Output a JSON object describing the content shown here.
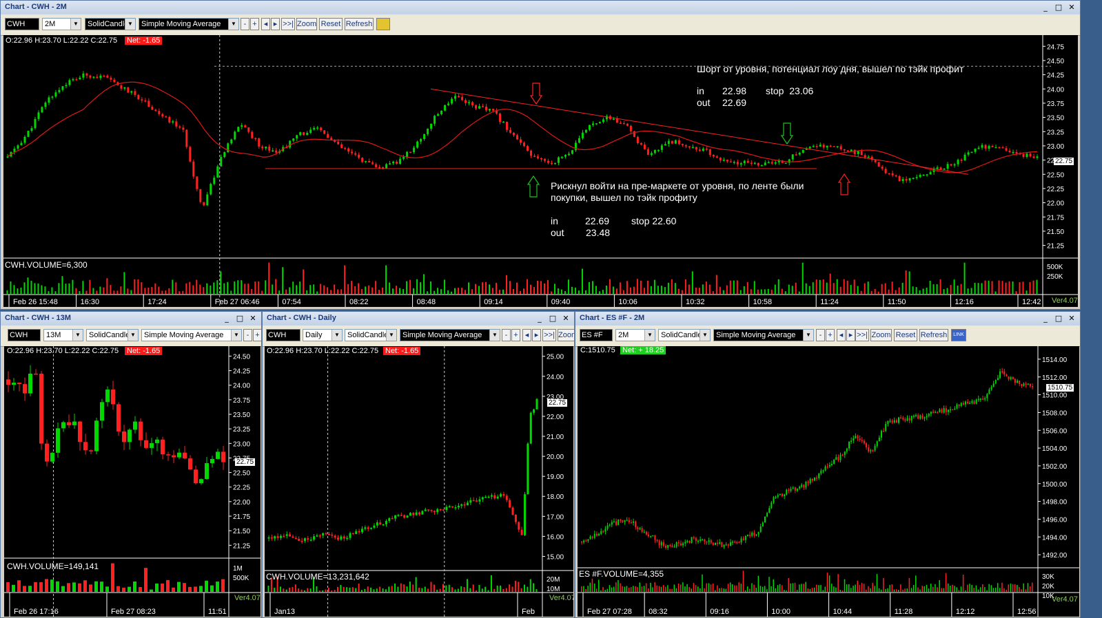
{
  "colors": {
    "up": "#00d800",
    "down": "#ff2020",
    "ma": "#e01818",
    "window_bg": "#d4d0c8",
    "net_neg": "#ff1a1a",
    "net_pos": "#20d020"
  },
  "toolbar_common": {
    "chart_type": "SolidCandle",
    "indicator": "Simple Moving Average",
    "minus": "-",
    "plus": "+",
    "left": "◂",
    "right": "▸",
    "end": ">>|",
    "zoom": "Zoom",
    "reset": "Reset",
    "refresh": "Refresh"
  },
  "main": {
    "title": "Chart - CWH - 2M",
    "symbol": "CWH",
    "interval": "2M",
    "ohlc": "O:22.96   H:23.70   L:22.22   C:22.75",
    "net": "Net: -1.65",
    "volume_label": "CWH.VOLUME=6,300",
    "y_ticks": [
      "24.75",
      "24.50",
      "24.25",
      "24.00",
      "23.75",
      "23.50",
      "23.25",
      "23.00",
      "22.75",
      "22.50",
      "22.25",
      "22.00",
      "21.75",
      "21.50",
      "21.25"
    ],
    "vol_ticks": [
      "500K",
      "250K"
    ],
    "x_ticks": [
      "Feb 26 15:48",
      "16:30",
      "17:24",
      "Feb 27 06:46",
      "07:54",
      "08:22",
      "08:48",
      "09:14",
      "09:40",
      "10:06",
      "10:32",
      "10:58",
      "11:24",
      "11:50",
      "12:16",
      "12:42"
    ],
    "last_price": "22.75",
    "version": "Ver4.07",
    "note_short": "Шорт от уровня, потенциал лоу дня, вышел по тэйк профит",
    "note_short_in_label": "in",
    "note_short_in": "22.98",
    "note_short_stop": "stop  23.06",
    "note_short_out_label": "out",
    "note_short_out": "22.69",
    "note_long": "Рискнул войти на пре-маркете от уровня, по ленте были\nпокупки, вышел по тэйк профиту",
    "note_long_in_label": "in",
    "note_long_in": "22.69",
    "note_long_stop": "stop 22.60",
    "note_long_out_label": "out",
    "note_long_out": "23.48"
  },
  "w13": {
    "title": "Chart - CWH - 13M",
    "symbol": "CWH",
    "interval": "13M",
    "ohlc": "O:22.96   H:23.70   L:22.22   C:22.75",
    "net": "Net: -1.65",
    "volume_label": "CWH.VOLUME=149,141",
    "y_ticks": [
      "24.50",
      "24.25",
      "24.00",
      "23.75",
      "23.50",
      "23.25",
      "23.00",
      "22.75",
      "22.50",
      "22.25",
      "22.00",
      "21.75",
      "21.50",
      "21.25"
    ],
    "vol_ticks": [
      "1M",
      "500K"
    ],
    "x_ticks": [
      "Feb 26 17:16",
      "Feb 27 08:23",
      "11:51"
    ],
    "last_price": "22.75",
    "version": "Ver4.07"
  },
  "daily": {
    "title": "Chart - CWH - Daily",
    "symbol": "CWH",
    "interval": "Daily",
    "ohlc": "O:22.96   H:23.70   L:22.22   C:22.75",
    "net": "Net: -1.65",
    "volume_label": "CWH.VOLUME=13,231,642",
    "y_ticks": [
      "25.00",
      "24.00",
      "23.00",
      "22.00",
      "21.00",
      "20.00",
      "19.00",
      "18.00",
      "17.00",
      "16.00",
      "15.00"
    ],
    "vol_ticks": [
      "20M",
      "10M"
    ],
    "x_ticks": [
      "Jan13",
      "Feb"
    ],
    "last_price": "22.75",
    "version": "Ver4.07",
    "zoom": "Zoom"
  },
  "es": {
    "title": "Chart - ES #F - 2M",
    "symbol": "ES #F",
    "interval": "2M",
    "ohlc": "C:1510.75",
    "net": "Net: + 18.25",
    "volume_label": "ES #F.VOLUME=4,355",
    "y_ticks": [
      "1514.00",
      "1512.00",
      "1510.00",
      "1508.00",
      "1506.00",
      "1504.00",
      "1502.00",
      "1500.00",
      "1498.00",
      "1496.00",
      "1494.00",
      "1492.00"
    ],
    "vol_ticks": [
      "30K",
      "20K",
      "10K"
    ],
    "x_ticks": [
      "Feb 27 07:28",
      "08:32",
      "09:16",
      "10:00",
      "10:44",
      "11:28",
      "12:12",
      "12:56"
    ],
    "last_price": "1510.75",
    "version": "Ver4.07",
    "link": "LINK"
  },
  "chart_data": [
    {
      "type": "candlestick",
      "symbol": "CWH",
      "interval": "2M",
      "ylim": [
        21.1,
        24.85
      ],
      "moving_average": "Simple Moving Average",
      "close_points": [
        [
          0,
          22.8
        ],
        [
          1,
          23.2
        ],
        [
          2,
          23.8
        ],
        [
          3,
          24.1
        ],
        [
          4,
          24.25
        ],
        [
          5,
          24.2
        ],
        [
          6,
          24.0
        ],
        [
          7,
          23.8
        ],
        [
          8,
          23.5
        ],
        [
          9,
          23.3
        ],
        [
          10,
          21.9
        ],
        [
          11,
          22.8
        ],
        [
          12,
          23.4
        ],
        [
          13,
          23.0
        ],
        [
          14,
          22.9
        ],
        [
          15,
          23.2
        ],
        [
          16,
          23.3
        ],
        [
          17,
          23.0
        ],
        [
          18,
          22.8
        ],
        [
          19,
          22.6
        ],
        [
          20,
          22.7
        ],
        [
          21,
          23.0
        ],
        [
          22,
          23.5
        ],
        [
          23,
          23.9
        ],
        [
          24,
          23.7
        ],
        [
          25,
          23.6
        ],
        [
          26,
          23.2
        ],
        [
          27,
          22.8
        ],
        [
          28,
          22.7
        ],
        [
          29,
          22.9
        ],
        [
          30,
          23.4
        ],
        [
          31,
          23.5
        ],
        [
          32,
          23.3
        ],
        [
          33,
          22.8
        ],
        [
          34,
          23.1
        ],
        [
          35,
          23.0
        ],
        [
          36,
          22.9
        ],
        [
          37,
          22.7
        ],
        [
          38,
          22.7
        ],
        [
          39,
          22.68
        ],
        [
          40,
          22.72
        ],
        [
          41,
          22.95
        ],
        [
          42,
          23.0
        ],
        [
          43,
          22.95
        ],
        [
          44,
          22.85
        ],
        [
          45,
          22.6
        ],
        [
          46,
          22.4
        ],
        [
          47,
          22.5
        ],
        [
          48,
          22.6
        ],
        [
          49,
          22.75
        ],
        [
          50,
          23.0
        ],
        [
          51,
          22.95
        ],
        [
          52,
          22.85
        ],
        [
          53,
          22.8
        ]
      ]
    },
    {
      "type": "candlestick",
      "symbol": "CWH",
      "interval": "13M",
      "ylim": [
        21.1,
        24.6
      ],
      "close_points": [
        [
          0,
          24.1
        ],
        [
          1,
          24.0
        ],
        [
          2,
          23.95
        ],
        [
          3,
          24.25
        ],
        [
          4,
          22.5
        ],
        [
          5,
          23.0
        ],
        [
          6,
          23.3
        ],
        [
          7,
          23.4
        ],
        [
          8,
          23.1
        ],
        [
          9,
          22.7
        ],
        [
          10,
          23.6
        ],
        [
          11,
          24.0
        ],
        [
          12,
          23.4
        ],
        [
          13,
          23.1
        ],
        [
          14,
          23.5
        ],
        [
          15,
          22.9
        ],
        [
          16,
          23.1
        ],
        [
          17,
          22.9
        ],
        [
          18,
          22.8
        ],
        [
          19,
          22.95
        ],
        [
          20,
          22.7
        ],
        [
          21,
          22.4
        ],
        [
          22,
          22.6
        ],
        [
          23,
          22.9
        ],
        [
          24,
          22.8
        ]
      ]
    },
    {
      "type": "candlestick",
      "symbol": "CWH",
      "interval": "Daily",
      "ylim": [
        14.5,
        25.3
      ],
      "close_points": [
        [
          0,
          15.9
        ],
        [
          5,
          16.0
        ],
        [
          10,
          15.8
        ],
        [
          15,
          16.2
        ],
        [
          20,
          15.9
        ],
        [
          25,
          16.3
        ],
        [
          30,
          16.6
        ],
        [
          35,
          17.0
        ],
        [
          40,
          17.1
        ],
        [
          45,
          17.3
        ],
        [
          50,
          17.5
        ],
        [
          55,
          17.7
        ],
        [
          60,
          17.9
        ],
        [
          65,
          18.1
        ],
        [
          70,
          16.0
        ],
        [
          72,
          22.0
        ],
        [
          74,
          22.75
        ]
      ]
    },
    {
      "type": "candlestick",
      "symbol": "ES #F",
      "interval": "2M",
      "ylim": [
        1491.0,
        1515.0
      ],
      "close_points": [
        [
          0,
          1493.5
        ],
        [
          10,
          1495.5
        ],
        [
          14,
          1496.0
        ],
        [
          20,
          1494.5
        ],
        [
          26,
          1492.8
        ],
        [
          35,
          1493.8
        ],
        [
          45,
          1493.0
        ],
        [
          55,
          1494.5
        ],
        [
          60,
          1498.5
        ],
        [
          70,
          1500.0
        ],
        [
          80,
          1503.0
        ],
        [
          85,
          1505.5
        ],
        [
          90,
          1503.5
        ],
        [
          95,
          1507.0
        ],
        [
          105,
          1507.5
        ],
        [
          115,
          1508.5
        ],
        [
          125,
          1509.5
        ],
        [
          130,
          1512.5
        ],
        [
          135,
          1511.5
        ],
        [
          140,
          1510.75
        ]
      ]
    }
  ]
}
